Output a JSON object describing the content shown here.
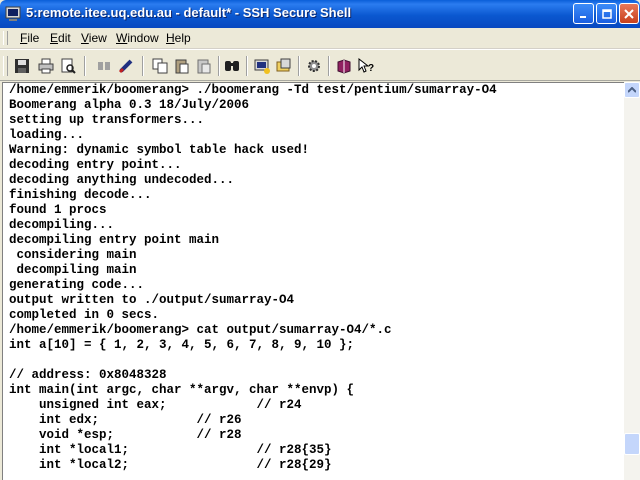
{
  "window": {
    "title": "5:remote.itee.uq.edu.au - default* - SSH Secure Shell"
  },
  "menu": {
    "items": [
      {
        "accel": "F",
        "rest": "ile"
      },
      {
        "accel": "E",
        "rest": "dit"
      },
      {
        "accel": "V",
        "rest": "iew"
      },
      {
        "accel": "W",
        "rest": "indow"
      },
      {
        "accel": "H",
        "rest": "elp"
      }
    ]
  },
  "toolbar": {
    "icons": [
      "save-icon",
      "print-icon",
      "print-preview-icon",
      "disconnect-icon",
      "connect-icon",
      "copy-icon",
      "paste-icon",
      "paste-special-icon",
      "find-icon",
      "new-terminal-icon",
      "new-file-transfer-icon",
      "settings-icon",
      "help-topics-icon",
      "context-help-icon"
    ]
  },
  "terminal": {
    "lines": [
      "/home/emmerik/boomerang> ./boomerang -Td test/pentium/sumarray-O4",
      "Boomerang alpha 0.3 18/July/2006",
      "setting up transformers...",
      "loading...",
      "Warning: dynamic symbol table hack used!",
      "decoding entry point...",
      "decoding anything undecoded...",
      "finishing decode...",
      "found 1 procs",
      "decompiling...",
      "decompiling entry point main",
      " considering main",
      " decompiling main",
      "generating code...",
      "output written to ./output/sumarray-O4",
      "completed in 0 secs.",
      "/home/emmerik/boomerang> cat output/sumarray-O4/*.c",
      "int a[10] = { 1, 2, 3, 4, 5, 6, 7, 8, 9, 10 };",
      "",
      "// address: 0x8048328",
      "int main(int argc, char **argv, char **envp) {",
      "    unsigned int eax;            // r24",
      "    int edx;             // r26",
      "    void *esp;           // r28",
      "    int *local1;                 // r28{35}",
      "    int *local2;                 // r28{29}"
    ]
  },
  "scrollbar": {
    "position": 0.93
  }
}
